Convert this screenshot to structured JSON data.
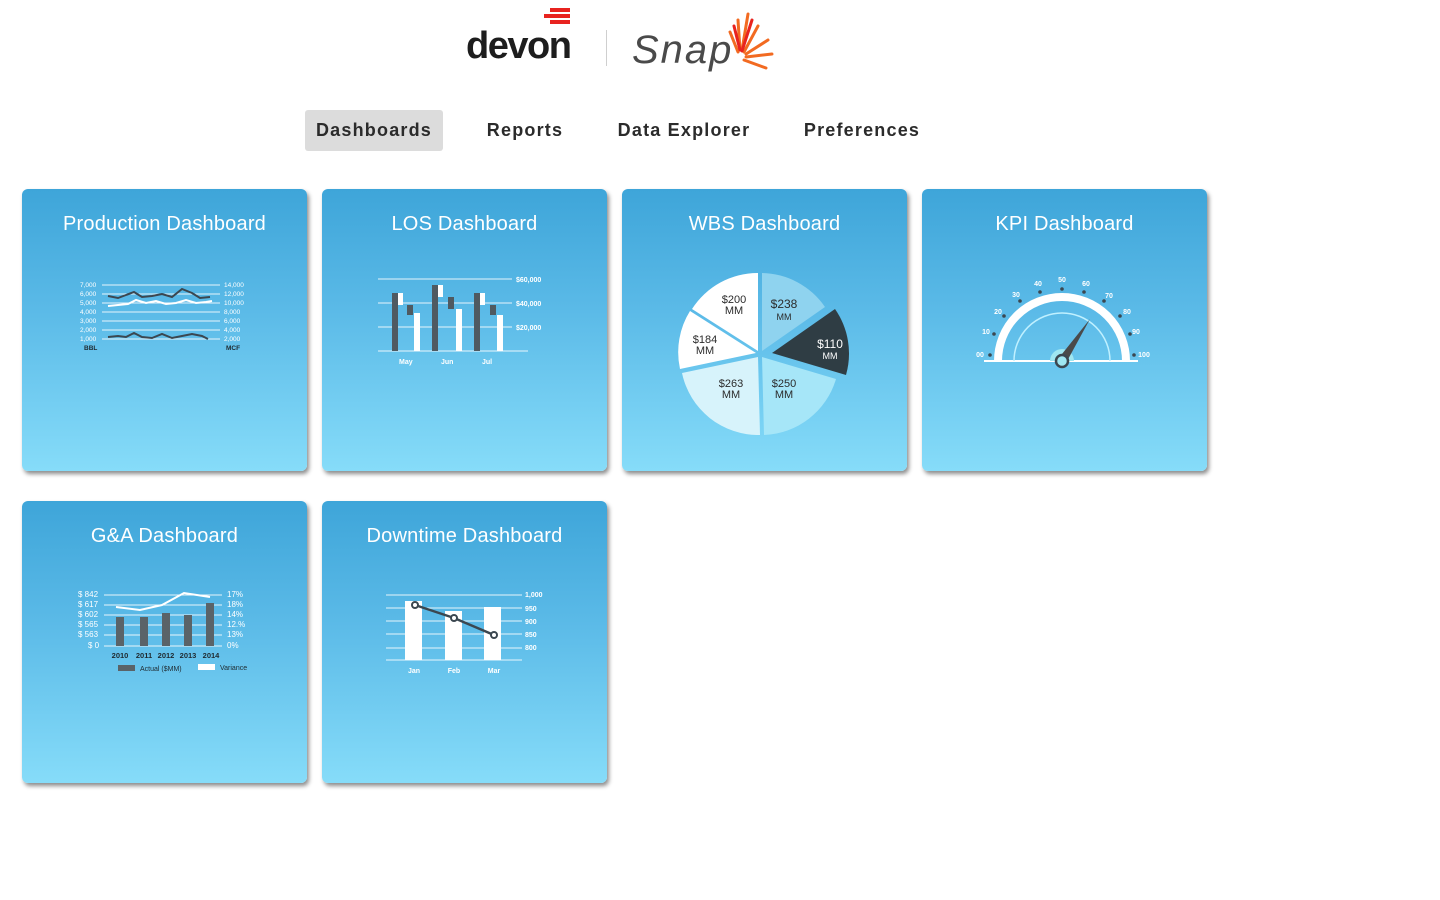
{
  "brand": {
    "company": "devon",
    "product": "Snap",
    "company_color": "#e8231f",
    "product_color": "#f26a21"
  },
  "nav": {
    "items": [
      {
        "label": "Dashboards",
        "active": true
      },
      {
        "label": "Reports",
        "active": false
      },
      {
        "label": "Data Explorer",
        "active": false
      },
      {
        "label": "Preferences",
        "active": false
      }
    ]
  },
  "tiles": [
    {
      "title": "Production Dashboard",
      "icon": "line-chart-icon",
      "left_axis": [
        "7,000",
        "6,000",
        "5,000",
        "4,000",
        "3,000",
        "2,000",
        "1,000"
      ],
      "right_axis": [
        "14,000",
        "12,000",
        "10,000",
        "8,000",
        "6,000",
        "4,000",
        "2,000"
      ],
      "left_unit": "BBL",
      "right_unit": "MCF"
    },
    {
      "title": "LOS Dashboard",
      "icon": "bar-chart-icon",
      "right_axis": [
        "$60,000",
        "$40,000",
        "$20,000"
      ],
      "categories": [
        "May",
        "Jun",
        "Jul"
      ]
    },
    {
      "title": "WBS Dashboard",
      "icon": "pie-chart-icon",
      "slices": [
        {
          "value": "$238",
          "unit": "MM"
        },
        {
          "value": "$110",
          "unit": "MM"
        },
        {
          "value": "$250",
          "unit": "MM"
        },
        {
          "value": "$263",
          "unit": "MM"
        },
        {
          "value": "$184",
          "unit": "MM"
        },
        {
          "value": "$200",
          "unit": "MM"
        }
      ]
    },
    {
      "title": "KPI Dashboard",
      "icon": "gauge-icon",
      "gauge_labels": [
        "00",
        "10",
        "20",
        "30",
        "40",
        "50",
        "60",
        "70",
        "80",
        "90",
        "100"
      ]
    },
    {
      "title": "G&A Dashboard",
      "icon": "combo-chart-icon",
      "left_axis": [
        "$ 842",
        "$ 617",
        "$ 602",
        "$ 565",
        "$ 563",
        "$ 0"
      ],
      "right_axis": [
        "17%",
        "18%",
        "14%",
        "12.%",
        "13%",
        "0%"
      ],
      "categories": [
        "2010",
        "2011",
        "2012",
        "2013",
        "2014"
      ],
      "legend": [
        "Actual ($MM)",
        "Variance"
      ]
    },
    {
      "title": "Downtime Dashboard",
      "icon": "bar-line-chart-icon",
      "right_axis": [
        "1,000",
        "950",
        "900",
        "850",
        "800"
      ],
      "categories": [
        "Jan",
        "Feb",
        "Mar"
      ]
    }
  ]
}
